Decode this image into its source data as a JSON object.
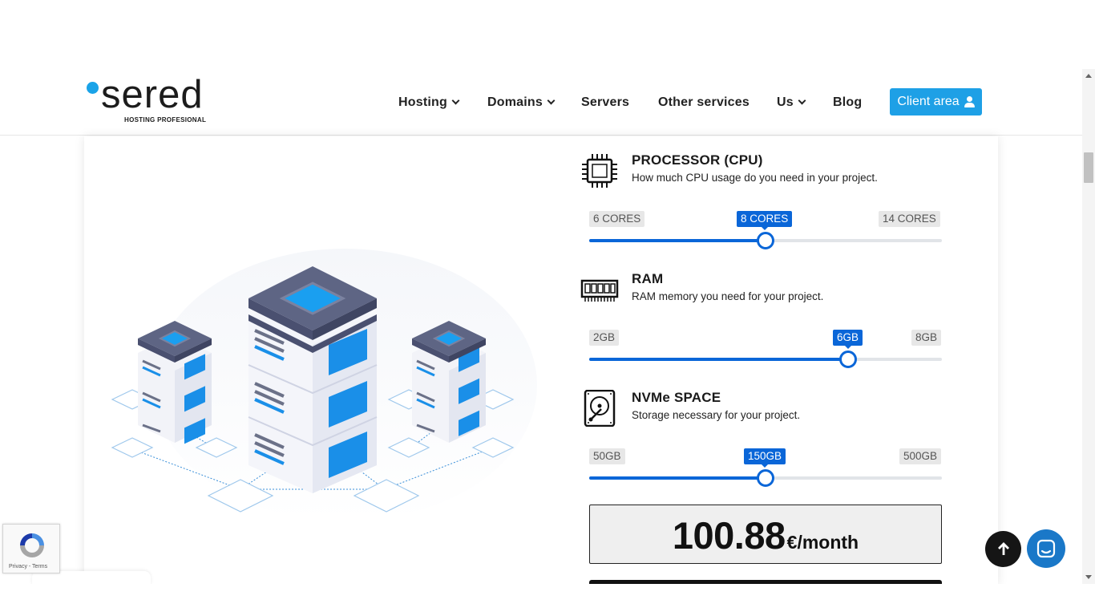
{
  "brand": {
    "name": "sered",
    "tagline": "HOSTING PROFESIONAL",
    "accent": "#1aa3e8"
  },
  "nav": {
    "items": [
      {
        "label": "Hosting",
        "dropdown": true
      },
      {
        "label": "Domains",
        "dropdown": true
      },
      {
        "label": "Servers",
        "dropdown": false
      },
      {
        "label": "Other services",
        "dropdown": false
      },
      {
        "label": "Us",
        "dropdown": true
      },
      {
        "label": "Blog",
        "dropdown": false
      }
    ],
    "client_area": "Client area"
  },
  "config": {
    "cpu": {
      "title": "PROCESSOR (CPU)",
      "desc": "How much CPU usage do you need in your project.",
      "min": "6 CORES",
      "value": "8 CORES",
      "max": "14 CORES",
      "fraction": 0.5
    },
    "ram": {
      "title": "RAM",
      "desc": "RAM memory you need for your project.",
      "min": "2GB",
      "value": "6GB",
      "max": "8GB",
      "fraction": 0.733
    },
    "storage": {
      "title": "NVMe SPACE",
      "desc": "Storage necessary for your project.",
      "min": "50GB",
      "value": "150GB",
      "max": "500GB",
      "fraction": 0.5
    }
  },
  "price": {
    "amount": "100.88",
    "unit": "€/month"
  },
  "recaptcha": {
    "label": "Privacy - Terms"
  },
  "colors": {
    "slider": "#0a66d8",
    "button": "#1ea0e6",
    "chat": "#1a78c8"
  }
}
